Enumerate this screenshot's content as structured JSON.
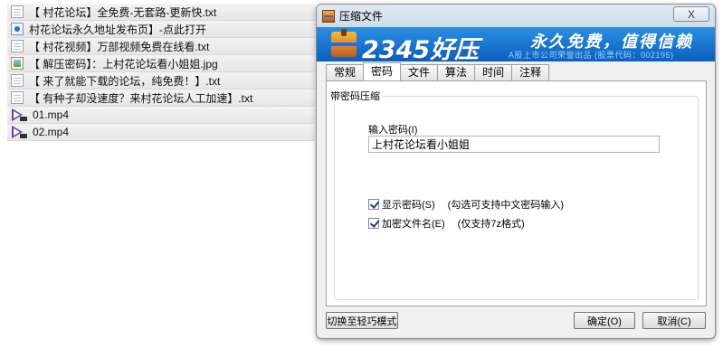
{
  "files": [
    {
      "icon": "txt-file-icon",
      "name": "【 村花论坛】全免费-无套路-更新快.txt"
    },
    {
      "icon": "url-file-icon",
      "name": "村花论坛永久地址发布页】-点此打开"
    },
    {
      "icon": "txt-file-icon",
      "name": "【 村花视频】万部视频免费在线看.txt"
    },
    {
      "icon": "jpg-file-icon",
      "name": "【 解压密码】：上村花论坛看小姐姐.jpg"
    },
    {
      "icon": "txt-file-icon",
      "name": "【 来了就能下载的论坛，纯免费！】.txt"
    },
    {
      "icon": "txt-file-icon",
      "name": "【 有种子却没速度？来村花论坛人工加速】.txt"
    },
    {
      "icon": "video-file-icon",
      "name": "01.mp4"
    },
    {
      "icon": "video-file-icon",
      "name": "02.mp4"
    }
  ],
  "dialog": {
    "title": "压缩文件",
    "close_label": "X",
    "banner": {
      "logo": "2345好压",
      "slogan": "永久免费，值得信赖",
      "sub": "A股上市公司荣誉出品 (股票代码：002195)"
    },
    "tabs": [
      "常规",
      "密码",
      "文件",
      "算法",
      "时间",
      "注释"
    ],
    "active_tab": "密码",
    "group_title": "带密码压缩",
    "password_label": "输入密码(I)",
    "password_value": "上村花论坛看小姐姐",
    "show_password": {
      "label": "显示密码(S)",
      "hint": "(勾选可支持中文密码输入)",
      "checked": true
    },
    "encrypt_names": {
      "label": "加密文件名(E)",
      "hint": "(仅支持7z格式)",
      "checked": true
    },
    "buttons": {
      "lite_mode": "切换至轻巧模式",
      "ok": "确定(O)",
      "cancel": "取消(C)"
    }
  },
  "colors": {
    "banner_top": "#2a8fe3",
    "banner_bottom": "#0b5fbd",
    "titlebar": "#dfe9f5"
  }
}
